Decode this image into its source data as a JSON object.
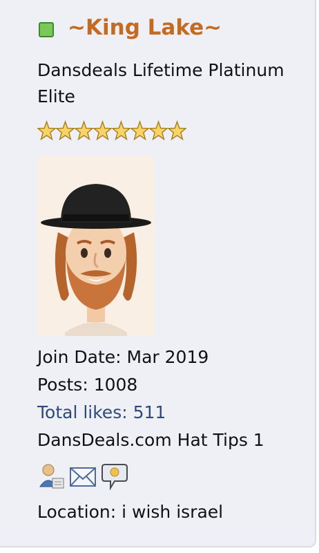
{
  "user": {
    "name": "~King Lake~",
    "title": "Dansdeals Lifetime Platinum Elite",
    "star_count": 8,
    "join_date": "Join Date: Mar 2019",
    "posts": "Posts: 1008",
    "total_likes": "Total likes: 511",
    "hat_tips": "DansDeals.com Hat Tips 1",
    "location": "Location: i wish israel"
  },
  "icons": [
    "profile-icon",
    "envelope-icon",
    "speech-bubble-icon"
  ],
  "colors": {
    "username": "#c46a21",
    "online": "#7cc75a",
    "link": "#2f4a7a",
    "panel": "#eef0f6"
  }
}
